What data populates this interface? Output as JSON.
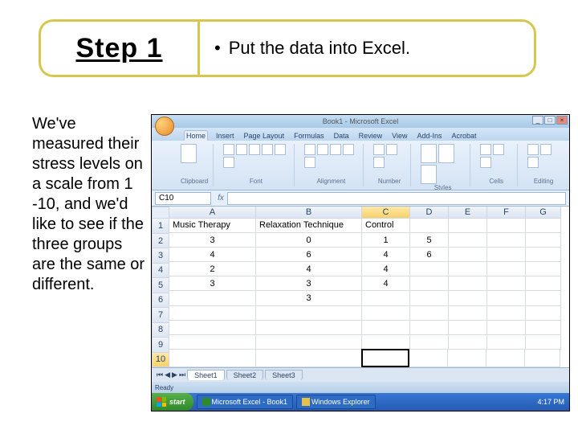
{
  "header": {
    "step_label": "Step 1",
    "bullet": "Put the data into Excel."
  },
  "body_text": "We've measured their stress levels on a scale from 1 -10, and we'd like to see if the three groups are the same or different.",
  "excel": {
    "window_title": "Book1 - Microsoft Excel",
    "tabs": [
      "Home",
      "Insert",
      "Page Layout",
      "Formulas",
      "Data",
      "Review",
      "View",
      "Add-Ins",
      "Acrobat"
    ],
    "active_tab": 0,
    "ribbon_groups": [
      "Clipboard",
      "Font",
      "Alignment",
      "Number",
      "Styles",
      "Cells",
      "Editing"
    ],
    "name_box_value": "C10",
    "formula_value": "",
    "columns": [
      "A",
      "B",
      "C",
      "D",
      "E",
      "F",
      "G"
    ],
    "selected_column": "C",
    "selected_row": 10,
    "rows": [
      {
        "n": 1,
        "a": "Music Therapy",
        "b": "Relaxation Technique",
        "c": "Control",
        "d": "",
        "e": "",
        "f": "",
        "g": ""
      },
      {
        "n": 2,
        "a": "3",
        "b": "0",
        "c": "1",
        "d": "5",
        "e": "",
        "f": "",
        "g": ""
      },
      {
        "n": 3,
        "a": "4",
        "b": "6",
        "c": "4",
        "d": "6",
        "e": "",
        "f": "",
        "g": ""
      },
      {
        "n": 4,
        "a": "2",
        "b": "4",
        "c": "4",
        "d": "",
        "e": "",
        "f": "",
        "g": ""
      },
      {
        "n": 5,
        "a": "3",
        "b": "3",
        "c": "4",
        "d": "",
        "e": "",
        "f": "",
        "g": ""
      },
      {
        "n": 6,
        "a": "",
        "b": "3",
        "c": "",
        "d": "",
        "e": "",
        "f": "",
        "g": ""
      },
      {
        "n": 7,
        "a": "",
        "b": "",
        "c": "",
        "d": "",
        "e": "",
        "f": "",
        "g": ""
      },
      {
        "n": 8,
        "a": "",
        "b": "",
        "c": "",
        "d": "",
        "e": "",
        "f": "",
        "g": ""
      },
      {
        "n": 9,
        "a": "",
        "b": "",
        "c": "",
        "d": "",
        "e": "",
        "f": "",
        "g": ""
      },
      {
        "n": 10,
        "a": "",
        "b": "",
        "c": "",
        "d": "",
        "e": "",
        "f": "",
        "g": ""
      }
    ],
    "sheet_tabs": [
      "Sheet1",
      "Sheet2",
      "Sheet3"
    ],
    "status_text": "Ready"
  },
  "taskbar": {
    "start_label": "start",
    "items": [
      {
        "label": "Microsoft Excel - Book1",
        "color": "#2e8a2a"
      },
      {
        "label": "Windows Explorer",
        "color": "#e6c14a"
      }
    ],
    "clock": "4:17 PM"
  },
  "chart_data": {
    "type": "table",
    "title": "Stress level data by group (1–10 scale)",
    "columns": [
      "Music Therapy",
      "Relaxation Technique",
      "Control"
    ],
    "series": [
      {
        "name": "Music Therapy",
        "values": [
          3,
          4,
          2,
          3
        ]
      },
      {
        "name": "Relaxation Technique",
        "values": [
          0,
          6,
          4,
          3,
          3
        ]
      },
      {
        "name": "Control",
        "values": [
          1,
          4,
          4,
          4
        ]
      }
    ],
    "extra_values_column_D": [
      5,
      6
    ]
  }
}
